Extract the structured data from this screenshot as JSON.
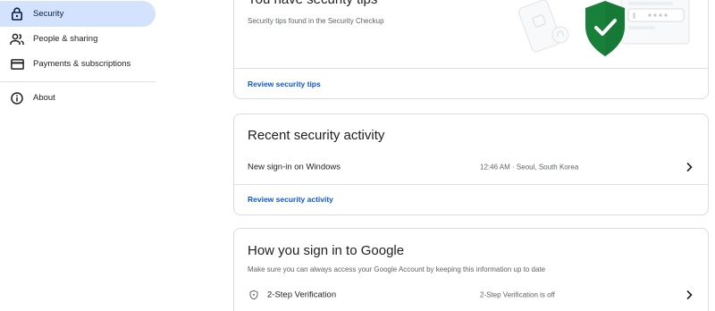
{
  "sidebar": {
    "items": [
      {
        "label": "Security",
        "icon": "lock-icon",
        "active": true
      },
      {
        "label": "People & sharing",
        "icon": "people-icon"
      },
      {
        "label": "Payments & subscriptions",
        "icon": "credit-card-icon"
      },
      {
        "label": "About",
        "icon": "info-icon"
      }
    ]
  },
  "security_tips": {
    "title": "You have security tips",
    "description": "Security tips found in the Security Checkup",
    "link": "Review security tips"
  },
  "recent_activity": {
    "title": "Recent security activity",
    "rows": [
      {
        "label": "New sign-in on Windows",
        "detail": "12:46 AM · Seoul, South Korea"
      }
    ],
    "link": "Review security activity"
  },
  "signin": {
    "title": "How you sign in to Google",
    "description": "Make sure you can always access your Google Account by keeping this information up to date",
    "rows": [
      {
        "label": "2-Step Verification",
        "detail": "2-Step Verification is off",
        "icon": "shield-icon"
      }
    ]
  },
  "colors": {
    "active_nav_bg": "#d3e3fd",
    "link": "#0b57d0",
    "shield_green": "#188038"
  }
}
